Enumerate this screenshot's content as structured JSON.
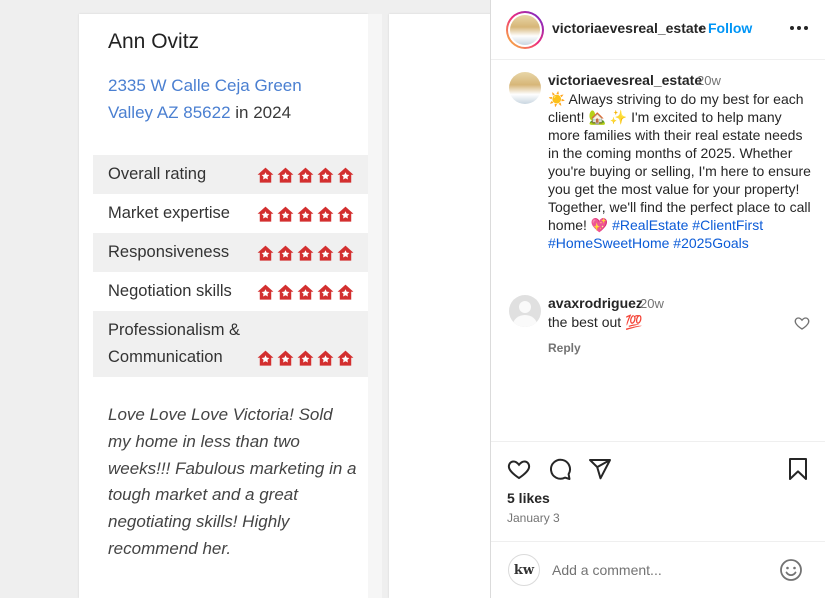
{
  "review": {
    "reviewer": "Ann Ovitz",
    "address_link": "2335 W Calle Ceja Green Valley AZ 85622",
    "address_suffix": " in 2024",
    "ratings": [
      {
        "label": "Overall rating",
        "stars": 5
      },
      {
        "label": "Market expertise",
        "stars": 5
      },
      {
        "label": "Responsiveness",
        "stars": 5
      },
      {
        "label": "Negotiation skills",
        "stars": 5
      },
      {
        "label": "Professionalism & Communication",
        "stars": 5
      }
    ],
    "quote": "Love Love Love Victoria! Sold my home in less than two weeks!!! Fabulous marketing in a tough market and a great negotiating skills! Highly recommend her.",
    "star_color": "#d32f2f"
  },
  "post": {
    "username": "victoriaevesreal_estate",
    "separator": "•",
    "follow_label": "Follow",
    "caption": {
      "username": "victoriaevesreal_estate",
      "time": "20w",
      "text_1": "☀️ Always striving to do my best for each client! 🏡 ✨ I'm excited to help many more families with their real estate needs in the coming months of 2025. Whether you're buying or selling, I'm here to ensure you get the most value for your property! Together, we'll find the perfect place to call home! 💖 ",
      "tags": [
        "#RealEstate",
        "#ClientFirst",
        "#HomeSweetHome",
        "#2025Goals"
      ]
    },
    "comment": {
      "username": "avaxrodriguez",
      "time": "20w",
      "text": "the best out 💯",
      "reply_label": "Reply"
    },
    "likes": "5 likes",
    "date": "January 3",
    "composer": {
      "avatar_text": "kw",
      "placeholder": "Add a comment..."
    },
    "accent_color": "#0095f6"
  }
}
